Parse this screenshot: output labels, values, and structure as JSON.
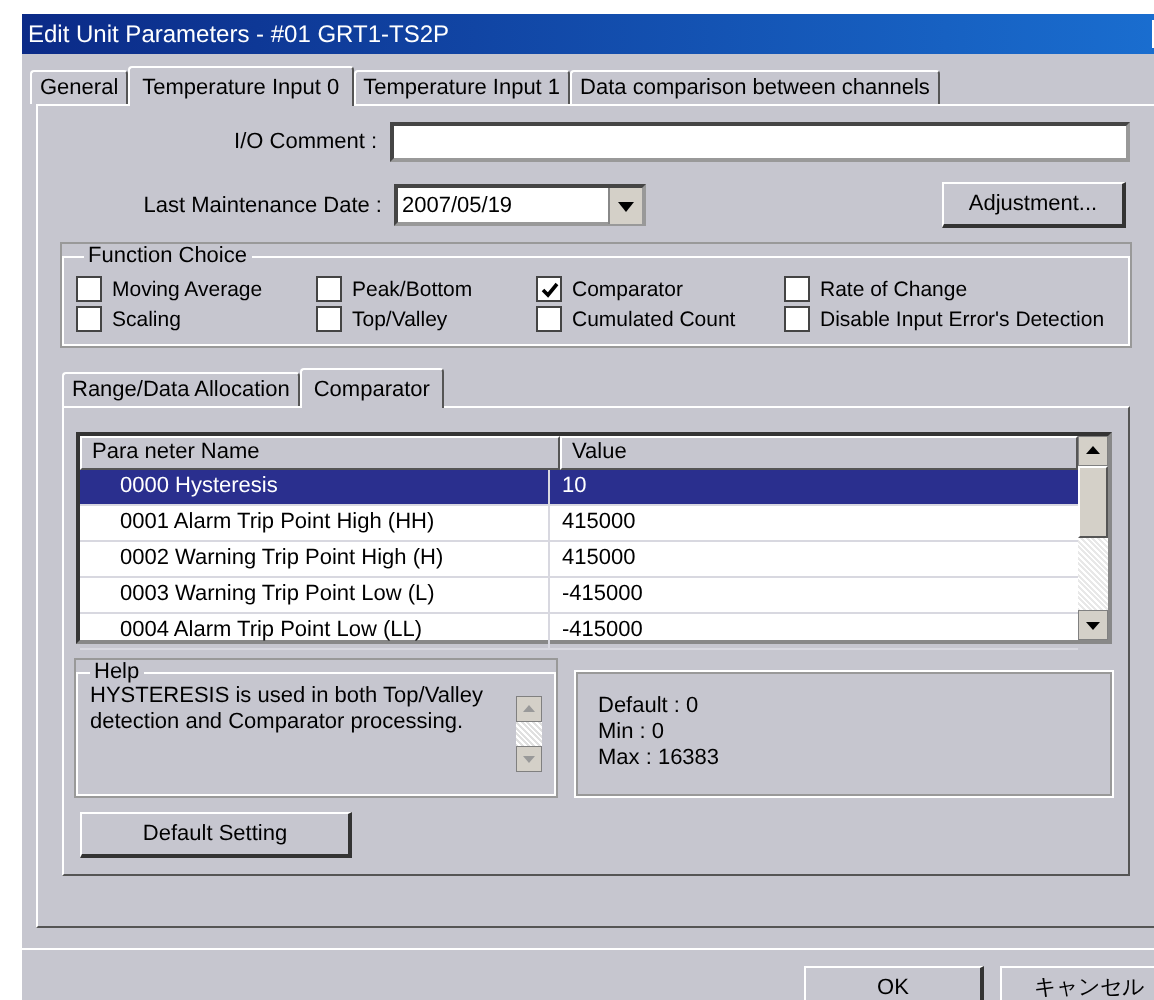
{
  "window": {
    "title": "Edit Unit Parameters - #01 GRT1-TS2P"
  },
  "tabs": [
    {
      "label": "General",
      "selected": false
    },
    {
      "label": "Temperature Input 0",
      "selected": true
    },
    {
      "label": "Temperature Input 1",
      "selected": false
    },
    {
      "label": "Data comparison between channels",
      "selected": false
    }
  ],
  "io_comment": {
    "label": "I/O Comment :"
  },
  "maintenance_date": {
    "label": "Last Maintenance Date :",
    "value": "2007/05/19"
  },
  "adjustment_button": "Adjustment...",
  "function_choice": {
    "title": "Function Choice",
    "options": [
      {
        "label": "Moving Average",
        "checked": false
      },
      {
        "label": "Peak/Bottom",
        "checked": false
      },
      {
        "label": "Comparator",
        "checked": true
      },
      {
        "label": "Rate of Change",
        "checked": false
      },
      {
        "label": "Scaling",
        "checked": false
      },
      {
        "label": "Top/Valley",
        "checked": false
      },
      {
        "label": "Cumulated Count",
        "checked": false
      },
      {
        "label": "Disable Input Error's Detection",
        "checked": false
      }
    ]
  },
  "sub_tabs": [
    {
      "label": "Range/Data Allocation",
      "selected": false
    },
    {
      "label": "Comparator",
      "selected": true
    }
  ],
  "table": {
    "columns": [
      "Para neter Name",
      "Value"
    ],
    "rows": [
      {
        "name": "0000 Hysteresis",
        "value": "10",
        "selected": true
      },
      {
        "name": "0001 Alarm Trip Point High (HH)",
        "value": "415000",
        "selected": false
      },
      {
        "name": "0002 Warning Trip Point High (H)",
        "value": "415000",
        "selected": false
      },
      {
        "name": "0003 Warning Trip Point Low (L)",
        "value": "-415000",
        "selected": false
      },
      {
        "name": "0004 Alarm Trip Point Low (LL)",
        "value": "-415000",
        "selected": false
      }
    ]
  },
  "help": {
    "title": "Help",
    "text": "HYSTERESIS is used in both Top/Valley detection and Comparator processing."
  },
  "range_info": [
    "Default : 0",
    "Min : 0",
    "Max : 16383"
  ],
  "default_setting_button": "Default Setting",
  "buttons": [
    "OK",
    "キャンセル"
  ]
}
